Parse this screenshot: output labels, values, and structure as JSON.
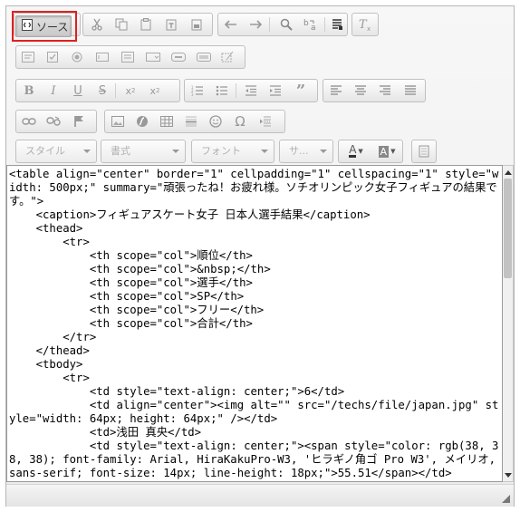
{
  "toolbar": {
    "source_label": "ソース",
    "icons_row1": [
      "cut-icon",
      "copy-icon",
      "paste-icon",
      "paste-text-icon",
      "paste-word-icon",
      "undo-icon",
      "redo-icon",
      "find-icon",
      "replace-icon",
      "select-all-icon",
      "remove-format-icon"
    ],
    "icons_row2": [
      "form-icon",
      "checkbox-icon",
      "radio-icon",
      "text-field-icon",
      "textarea-icon",
      "select-icon",
      "button-icon",
      "image-button-icon",
      "hidden-field-icon"
    ],
    "icons_row3": [
      "bold-icon",
      "italic-icon",
      "underline-icon",
      "strike-icon",
      "subscript-icon",
      "superscript-icon",
      "numbered-list-icon",
      "bulleted-list-icon",
      "outdent-icon",
      "indent-icon",
      "blockquote-icon",
      "align-left-icon",
      "align-center-icon",
      "align-right-icon",
      "justify-icon"
    ],
    "icons_row4": [
      "link-icon",
      "unlink-icon",
      "anchor-icon",
      "image-icon",
      "flash-icon",
      "table-icon",
      "horizontal-rule-icon",
      "smiley-icon",
      "special-char-icon",
      "page-break-icon"
    ],
    "combo_style": "スタイル",
    "combo_format": "書式",
    "combo_font": "フォント",
    "combo_size": "サ...",
    "text_color_label": "A",
    "bg_color_label": "A"
  },
  "source_code": "<table align=\"center\" border=\"1\" cellpadding=\"1\" cellspacing=\"1\" style=\"width: 500px;\" summary=\"頑張ったね！お疲れ様。ソチオリンピック女子フィギュアの結果です。\">\n    <caption>フィギュアスケート女子 日本人選手結果</caption>\n    <thead>\n        <tr>\n            <th scope=\"col\">順位</th>\n            <th scope=\"col\">&nbsp;</th>\n            <th scope=\"col\">選手</th>\n            <th scope=\"col\">SP</th>\n            <th scope=\"col\">フリー</th>\n            <th scope=\"col\">合計</th>\n        </tr>\n    </thead>\n    <tbody>\n        <tr>\n            <td style=\"text-align: center;\">6</td>\n            <td align=\"center\"><img alt=\"\" src=\"/techs/file/japan.jpg\" style=\"width: 64px; height: 64px;\" /></td>\n            <td>浅田 真央</td>\n            <td style=\"text-align: center;\"><span style=\"color: rgb(38, 38, 38); font-family: Arial, HiraKakuPro-W3, 'ヒラギノ角ゴ Pro W3', メイリオ, sans-serif; font-size: 14px; line-height: 18px;\">55.51</span></td>"
}
